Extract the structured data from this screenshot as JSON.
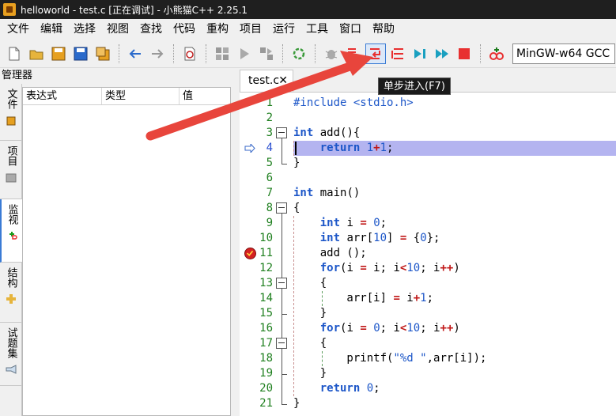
{
  "window": {
    "title": "helloworld - test.c [正在调试] - 小熊猫C++ 2.25.1"
  },
  "menu": [
    "文件",
    "编辑",
    "选择",
    "视图",
    "查找",
    "代码",
    "重构",
    "项目",
    "运行",
    "工具",
    "窗口",
    "帮助"
  ],
  "toolbar": {
    "compiler": "MinGW-w64 GCC",
    "tooltip": "单步进入(F7)",
    "icons": [
      "new-file-icon",
      "open-folder-icon",
      "save-icon",
      "save-all-icon",
      "save-copy-icon",
      "back-icon",
      "forward-icon",
      "spell-check-icon",
      "compile-icon",
      "run-icon",
      "compile-run-icon",
      "rebuild-icon",
      "debug-icon",
      "step-over-icon",
      "step-into-icon",
      "step-out-icon",
      "run-to-cursor-icon",
      "continue-icon",
      "stop-icon",
      "add-watch-icon"
    ]
  },
  "left_panel": {
    "title": "管理器",
    "side_tabs": [
      "文件",
      "项目",
      "监视",
      "结构",
      "试题集"
    ],
    "watch_columns": [
      "表达式",
      "类型",
      "值"
    ]
  },
  "editor": {
    "tab": "test.c",
    "close_glyph": "✕",
    "current_line": 4,
    "breakpoint_line": 11,
    "lines": [
      "#include <stdio.h>",
      "",
      "int add(){",
      "    return 1+1;",
      "}",
      "",
      "int main()",
      "{",
      "    int i = 0;",
      "    int arr[10] = {0};",
      "    add ();",
      "    for(i = i; i<10; i++)",
      "    {",
      "        arr[i] = i+1;",
      "    }",
      "    for(i = 0; i<10; i++)",
      "    {",
      "        printf(\"%d \",arr[i]);",
      "    }",
      "    return 0;",
      "}"
    ]
  },
  "colors": {
    "highlight": "#b4b4f0",
    "arrow": "#e8453c",
    "keyword": "#1c56c8",
    "line_number": "#208020"
  }
}
